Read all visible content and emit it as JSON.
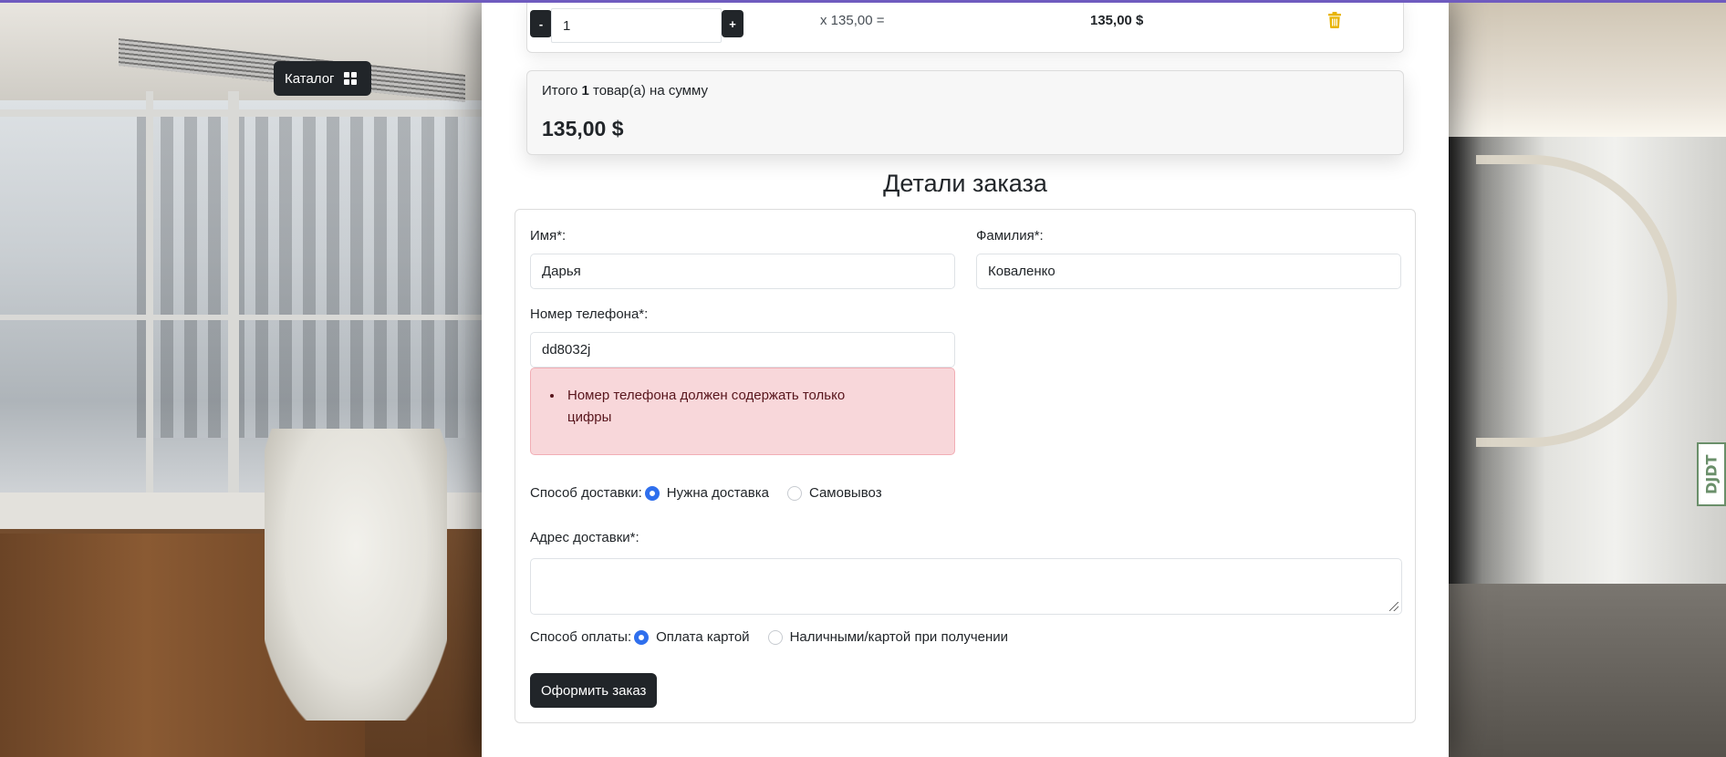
{
  "catalog": {
    "label": "Каталог",
    "icon": "grid-icon"
  },
  "cart": {
    "minus_label": "-",
    "plus_label": "+",
    "quantity": "1",
    "price_multiplier": "x 135,00 =",
    "row_total": "135,00 $",
    "delete_icon": "trash-icon",
    "delete_color": "#e8b400"
  },
  "summary": {
    "prefix": "Итого",
    "count": "1",
    "suffix": "товар(а) на сумму",
    "total": "135,00 $"
  },
  "order": {
    "title": "Детали заказа",
    "first_name_label": "Имя*:",
    "first_name_value": "Дарья",
    "last_name_label": "Фамилия*:",
    "last_name_value": "Коваленко",
    "phone_label": "Номер телефона*:",
    "phone_value": "dd8032j",
    "phone_error": "Номер телефона должен содержать только цифры",
    "delivery_label": "Способ доставки:",
    "delivery_options": [
      "Нужна доставка",
      "Самовывоз"
    ],
    "delivery_selected": "Нужна доставка",
    "address_label": "Адрес доставки*:",
    "address_value": "",
    "payment_label": "Способ оплаты:",
    "payment_options": [
      "Оплата картой",
      "Наличными/картой при получении"
    ],
    "payment_selected": "Оплата картой",
    "submit_label": "Оформить заказ"
  },
  "colors": {
    "accent": "#2f6fed",
    "dark_button": "#212529",
    "error_bg": "#f8d7da",
    "error_text": "#58151c"
  },
  "watermark": "DJDT"
}
